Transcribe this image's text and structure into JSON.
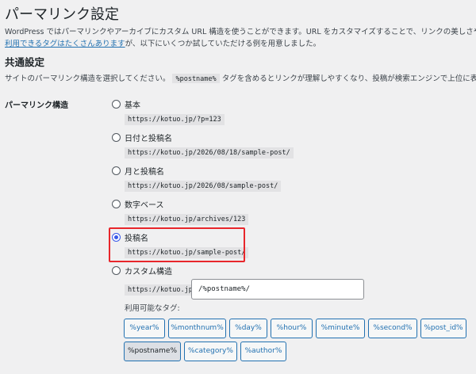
{
  "page": {
    "title": "パーマリンク設定",
    "intro_line1": "WordPress ではパーマリンクやアーカイブにカスタム URL 構造を使うことができます。URL をカスタマイズすることで、リンクの美しさや使いやすさ、そして前方互",
    "intro_link": "利用できるタグはたくさんあります",
    "intro_line2_rest": "が、以下にいくつか試していただける例を用意しました。",
    "section_title": "共通設定",
    "section_desc_before": "サイトのパーマリンク構造を選択してください。",
    "section_desc_code": "%postname%",
    "section_desc_after": "タグを含めるとリンクが理解しやすくなり、投稿が検索エンジンで上位に表示されるのに役立つ可能",
    "row_label": "パーマリンク構造"
  },
  "options": [
    {
      "label": "基本",
      "url": "https://kotuo.jp/?p=123",
      "checked": false
    },
    {
      "label": "日付と投稿名",
      "url": "https://kotuo.jp/2026/08/18/sample-post/",
      "checked": false
    },
    {
      "label": "月と投稿名",
      "url": "https://kotuo.jp/2026/08/sample-post/",
      "checked": false
    },
    {
      "label": "数字ベース",
      "url": "https://kotuo.jp/archives/123",
      "checked": false
    },
    {
      "label": "投稿名",
      "url": "https://kotuo.jp/sample-post/",
      "checked": true
    },
    {
      "label": "カスタム構造",
      "url": "",
      "checked": false
    }
  ],
  "custom": {
    "prefix": "https://kotuo.jp",
    "value": "/%postname%/",
    "tags_label": "利用可能なタグ:"
  },
  "tags": [
    {
      "label": "%year%",
      "active": false
    },
    {
      "label": "%monthnum%",
      "active": false
    },
    {
      "label": "%day%",
      "active": false
    },
    {
      "label": "%hour%",
      "active": false
    },
    {
      "label": "%minute%",
      "active": false
    },
    {
      "label": "%second%",
      "active": false
    },
    {
      "label": "%post_id%",
      "active": false
    },
    {
      "label": "%postname%",
      "active": true
    },
    {
      "label": "%category%",
      "active": false
    },
    {
      "label": "%author%",
      "active": false
    }
  ],
  "colors": {
    "accent": "#3858e9",
    "link": "#2271b1",
    "highlight_box": "#e8262b",
    "background": "#f0f0f1"
  }
}
